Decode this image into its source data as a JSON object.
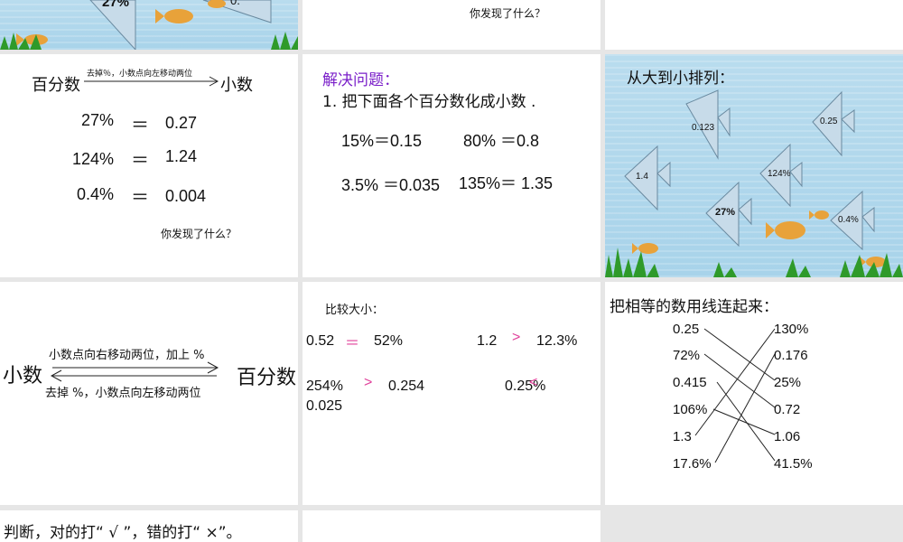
{
  "colors": {
    "sea": "#b9dcee",
    "grass": "#2f9a2a",
    "fish": "#e8a23a",
    "accent_purple": "#7a1fc9",
    "accent_pink": "#e0409a",
    "gap": "#e6e6e6"
  },
  "panel_top_left": {
    "fish_label_1": "27%",
    "fish_label_2": "0."
  },
  "panel_top_mid": {
    "question": "你发现了什么？"
  },
  "panel_percent_to_decimal": {
    "left_word": "百分数",
    "arrow_caption": "去掉％，小数点向左移动两位",
    "right_word": "小数",
    "rows": [
      {
        "left": "27%",
        "eq": "＝",
        "right": "0.27"
      },
      {
        "left": "124%",
        "eq": "＝",
        "right": "1.24"
      },
      {
        "left": "0.4%",
        "eq": "＝",
        "right": "0.004"
      }
    ],
    "question": "你发现了什么？"
  },
  "panel_solve": {
    "title": "解决问题：",
    "task": "1. 把下面各个百分数化成小数 .",
    "items": [
      "15%＝0.15",
      "80% ＝0.8",
      "3.5% ＝0.035",
      "135%＝ 1.35"
    ]
  },
  "panel_order": {
    "title": "从大到小排列：",
    "fish_labels": [
      "0.123",
      "0.25",
      "1.4",
      "124%",
      "27%",
      "0.4%"
    ]
  },
  "panel_conversion": {
    "left_word": "小数",
    "top_caption": "小数点向右移动两位，加上 %",
    "bottom_caption": "去掉 %，小数点向左移动两位",
    "right_word": "百分数"
  },
  "panel_compare": {
    "title": "比较大小：",
    "row1": {
      "a": "0.52",
      "op": "＝",
      "b": "52%",
      "c": "1.2",
      "op2": ">",
      "d": "12.3%"
    },
    "row2": {
      "a": "254%",
      "op": ">",
      "b": "0.254",
      "c": "0.25%",
      "op2": "<"
    },
    "row3": "0.025"
  },
  "panel_match": {
    "title": "把相等的数用线连起来：",
    "left": [
      "0.25",
      "72%",
      "0.415",
      "106%",
      "1.3",
      "17.6%"
    ],
    "right": [
      "130%",
      "0.176",
      "25%",
      "0.72",
      "1.06",
      "41.5%"
    ]
  },
  "panel_judge": {
    "title": "判断，对的打“ √ ”，错的打“ ×”。"
  }
}
